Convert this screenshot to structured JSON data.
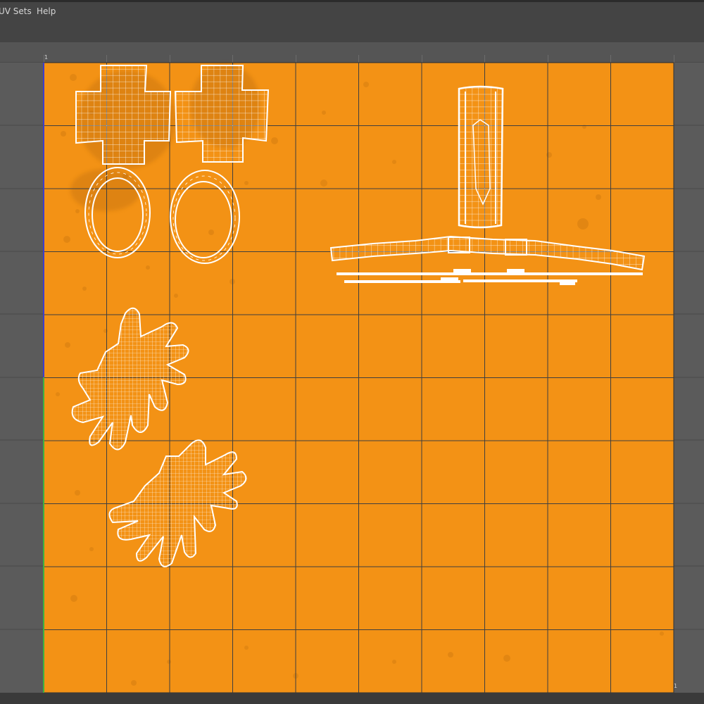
{
  "menu": {
    "items": [
      "UV Sets",
      "Help"
    ]
  },
  "ruler": {
    "top_left_label": "1",
    "bottom_right_label": "1"
  },
  "texture": {
    "base_color": "#f39215",
    "grid_line_color": "#3f3f3f",
    "wire_color": "#ffffff"
  },
  "uv_editor": {
    "grid_divisions": 10,
    "shells": [
      "cross-shell-left",
      "cross-shell-right",
      "ring-shell-left",
      "ring-shell-right",
      "boot-shaft-shell",
      "strap-shell",
      "strip-shell-1",
      "strip-shell-2",
      "strip-shell-3",
      "hand-shell-upper",
      "hand-shell-lower"
    ]
  }
}
